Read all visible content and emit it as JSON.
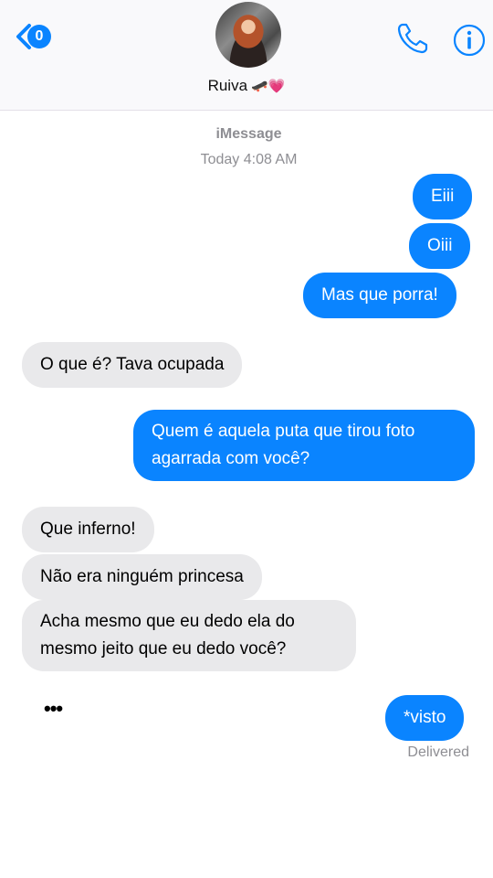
{
  "header": {
    "back_badge": "0",
    "contact_name": "Ruiva",
    "contact_emoji": "🛹💗"
  },
  "thread": {
    "service": "iMessage",
    "timestamp": "Today 4:08 AM",
    "messages": [
      {
        "from": "me",
        "text": "Eiii"
      },
      {
        "from": "me",
        "text": "Oiii"
      },
      {
        "from": "me",
        "text": "Mas que porra!"
      },
      {
        "from": "them",
        "text": "O que é? Tava ocupada"
      },
      {
        "from": "me",
        "text": "Quem é aquela puta que tirou foto agarrada com você?"
      },
      {
        "from": "them",
        "text": "Que inferno!"
      },
      {
        "from": "them",
        "text": "Não era ninguém princesa"
      },
      {
        "from": "them",
        "text": "Acha mesmo que eu dedo ela do mesmo jeito que eu dedo você?"
      },
      {
        "from": "me",
        "text": "*visto"
      }
    ],
    "typing_indicator": "•••",
    "delivered_label": "Delivered"
  },
  "colors": {
    "outgoing": "#0a84ff",
    "incoming": "#e9e9eb",
    "accent": "#0a84ff"
  },
  "icons": [
    "chevron-left-icon",
    "phone-icon",
    "info-icon"
  ]
}
